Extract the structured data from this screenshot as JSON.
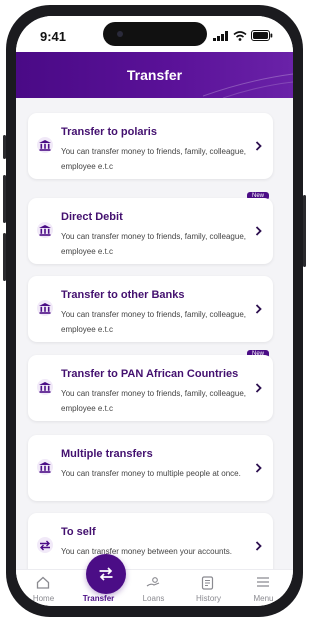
{
  "status_bar": {
    "time": "9:41"
  },
  "header": {
    "title": "Transfer"
  },
  "colors": {
    "brand": "#4b0d86",
    "title_text": "#43106f"
  },
  "options": [
    {
      "title": "Transfer to polaris",
      "description": "You can transfer money to friends, family, colleague, employee e.t.c",
      "icon": "bank-icon",
      "badge": ""
    },
    {
      "title": "Direct Debit",
      "description": "You can transfer money to friends, family, colleague, employee e.t.c",
      "icon": "bank-icon",
      "badge": "New"
    },
    {
      "title": "Transfer to other Banks",
      "description": "You can transfer money to friends, family, colleague, employee e.t.c",
      "icon": "bank-icon",
      "badge": ""
    },
    {
      "title": "Transfer to PAN African Countries",
      "description": "You can transfer money to friends, family, colleague, employee e.t.c",
      "icon": "bank-icon",
      "badge": "New"
    },
    {
      "title": "Multiple transfers",
      "description": "You can transfer money to multiple people at once.",
      "icon": "bank-icon",
      "badge": ""
    },
    {
      "title": "To self",
      "description": "You can transfer money between your accounts.",
      "icon": "swap-icon",
      "badge": ""
    }
  ],
  "tabbar": {
    "items": [
      {
        "label": "Home",
        "icon": "home-icon",
        "active": false
      },
      {
        "label": "Transfer",
        "icon": "swap-icon",
        "active": true
      },
      {
        "label": "Loans",
        "icon": "loans-icon",
        "active": false
      },
      {
        "label": "History",
        "icon": "history-icon",
        "active": false
      },
      {
        "label": "Menu",
        "icon": "menu-icon",
        "active": false
      }
    ]
  }
}
